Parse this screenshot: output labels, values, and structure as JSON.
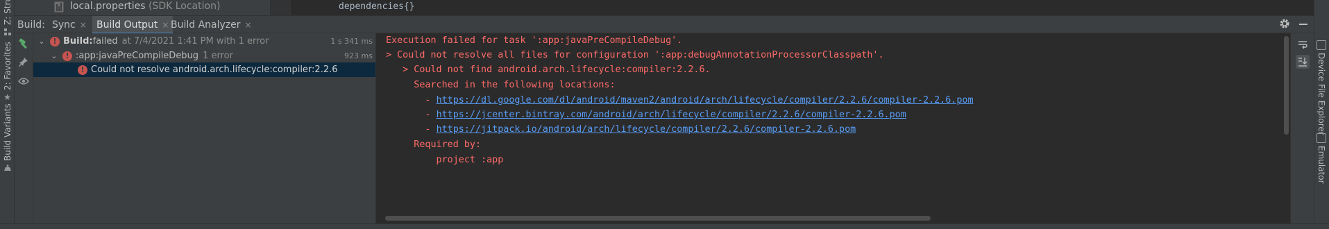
{
  "left_strip": {
    "tabs": [
      {
        "label": "Z: Structure",
        "icon": "structure-icon"
      },
      {
        "label": "2: Favorites",
        "icon": "star-icon"
      },
      {
        "label": "Build Variants",
        "icon": "build-variants-icon"
      }
    ]
  },
  "right_strip": {
    "tabs": [
      {
        "label": "Device File Explorer",
        "icon": "device-icon"
      },
      {
        "label": "Emulator",
        "icon": "emulator-icon"
      }
    ]
  },
  "top_strip": {
    "file_name": "local.properties",
    "file_hint": "(SDK Location)",
    "code_line": "dependencies{}"
  },
  "build_window": {
    "title": "Build:",
    "tabs": [
      {
        "label": "Sync",
        "active": false
      },
      {
        "label": "Build Output",
        "active": true
      },
      {
        "label": "Build Analyzer",
        "active": false
      }
    ],
    "close_glyph": "×"
  },
  "tree": {
    "rows": [
      {
        "label_bold": "Build:",
        "label": " failed",
        "detail": "at 7/4/2021 1:41 PM with 1 error",
        "time": "1 s 341 ms"
      },
      {
        "label": ":app:javaPreCompileDebug",
        "detail": "1 error",
        "time": "923 ms"
      },
      {
        "label": "Could not resolve android.arch.lifecycle:compiler:2.2.6"
      }
    ]
  },
  "console": {
    "lines": [
      {
        "text": "Execution failed for task ':app:javaPreCompileDebug'."
      },
      {
        "text": "> Could not resolve all files for configuration ':app:debugAnnotationProcessorClasspath'."
      },
      {
        "text": "   > Could not find android.arch.lifecycle:compiler:2.2.6."
      },
      {
        "text": "     Searched in the following locations:"
      },
      {
        "prefix": "       - ",
        "link": "https://dl.google.com/dl/android/maven2/android/arch/lifecycle/compiler/2.2.6/compiler-2.2.6.pom"
      },
      {
        "prefix": "       - ",
        "link": "https://jcenter.bintray.com/android/arch/lifecycle/compiler/2.2.6/compiler-2.2.6.pom"
      },
      {
        "prefix": "       - ",
        "link": "https://jitpack.io/android/arch/lifecycle/compiler/2.2.6/compiler-2.2.6.pom"
      },
      {
        "text": "     Required by:"
      },
      {
        "text": "         project :app"
      }
    ]
  },
  "colors": {
    "error_text": "#ff6b68",
    "link": "#589df6",
    "accent_tab": "#4a88c7",
    "error_icon": "#c75450"
  }
}
